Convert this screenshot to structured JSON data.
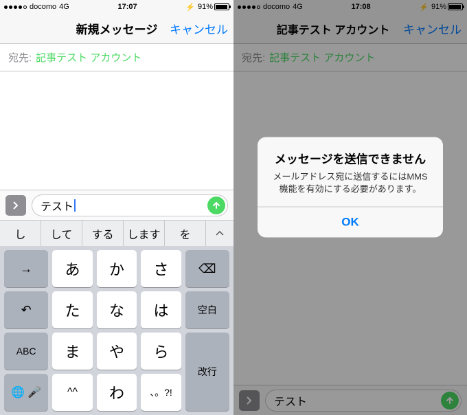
{
  "left": {
    "status": {
      "carrier": "docomo",
      "network": "4G",
      "time": "17:07",
      "battery": "91%"
    },
    "nav": {
      "title": "新規メッセージ",
      "cancel": "キャンセル"
    },
    "to": {
      "label": "宛先:",
      "value": "記事テスト アカウント"
    },
    "input": {
      "text": "テスト"
    },
    "suggestions": [
      "し",
      "して",
      "する",
      "します",
      "を"
    ],
    "keys": {
      "r1": [
        "あ",
        "か",
        "さ"
      ],
      "r2": [
        "た",
        "な",
        "は"
      ],
      "r3": [
        "ま",
        "や",
        "ら"
      ],
      "r4": [
        "^^",
        "わ",
        "、。?!"
      ],
      "space": "空白",
      "return": "改行",
      "abc": "ABC"
    }
  },
  "right": {
    "status": {
      "carrier": "docomo",
      "network": "4G",
      "time": "17:08",
      "battery": "91%"
    },
    "nav": {
      "title": "記事テスト アカウント",
      "cancel": "キャンセル"
    },
    "to": {
      "label": "宛先:",
      "value": "記事テスト アカウント"
    },
    "input": {
      "text": "テスト"
    },
    "alert": {
      "title": "メッセージを送信できません",
      "message": "メールアドレス宛に送信するにはMMS機能を有効にする必要があります。",
      "ok": "OK"
    }
  }
}
